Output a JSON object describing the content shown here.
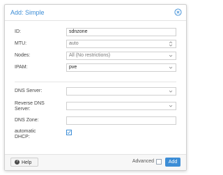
{
  "dialog": {
    "title": "Add: Simple",
    "fields": {
      "id": {
        "label": "ID:",
        "value": "sdnzone"
      },
      "mtu": {
        "label": "MTU:",
        "value": "auto"
      },
      "nodes": {
        "label": "Nodes:",
        "value": "All (No restrictions)"
      },
      "ipam": {
        "label": "IPAM:",
        "value": "pve"
      },
      "dns_server": {
        "label": "DNS Server:",
        "value": ""
      },
      "reverse_dns_server": {
        "label": "Reverse DNS Server:",
        "value": ""
      },
      "dns_zone": {
        "label": "DNS Zone:",
        "value": ""
      },
      "automatic_dhcp": {
        "label": "automatic DHCP:",
        "checked": true
      }
    }
  },
  "footer": {
    "help_label": "Help",
    "advanced_label": "Advanced",
    "advanced_checked": false,
    "add_label": "Add"
  },
  "colors": {
    "accent": "#3c8dd6"
  }
}
